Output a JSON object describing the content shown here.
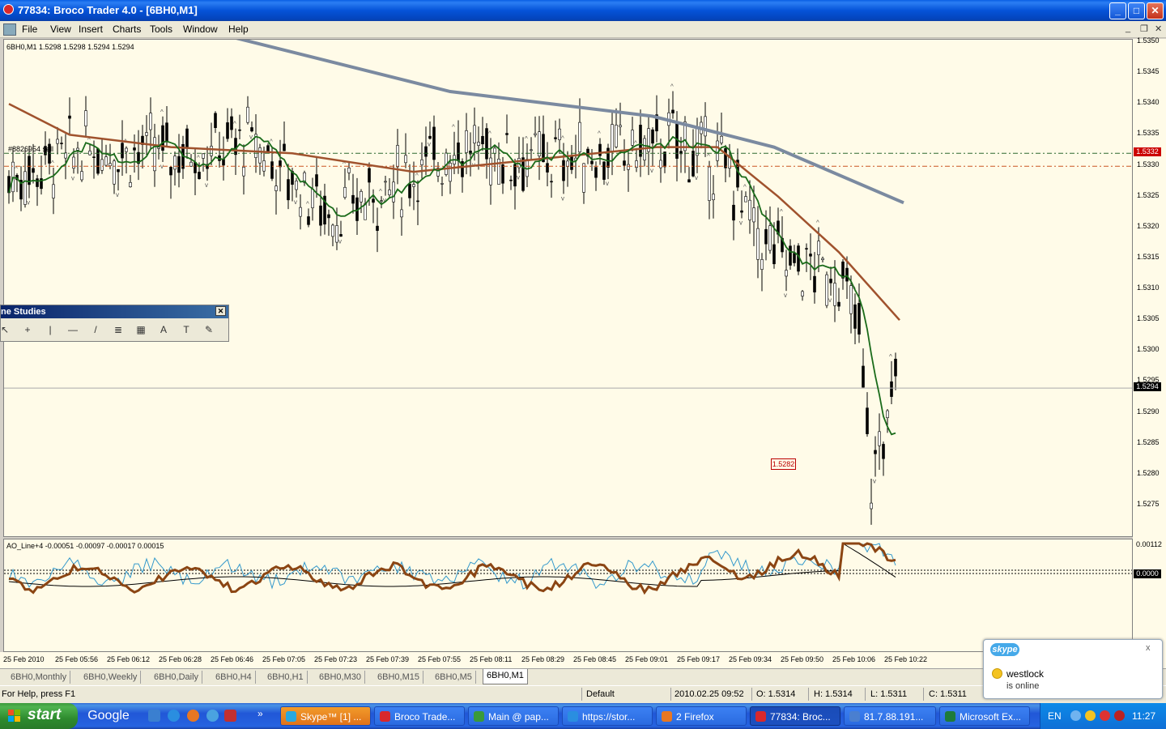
{
  "window": {
    "title": "77834: Broco Trader 4.0 - [6BH0,M1]",
    "buttons": {
      "minimize": "_",
      "maximize": "□",
      "close": "✕"
    }
  },
  "menu": [
    "File",
    "View",
    "Insert",
    "Charts",
    "Tools",
    "Window",
    "Help"
  ],
  "chart": {
    "header": "6BH0,M1  1.5298 1.5298 1.5294 1.5294",
    "current_price": "1.5294",
    "order_price": "1.5332",
    "order_label": "#8826954 sell",
    "alert_price": "1.5282",
    "price_ticks": [
      "1.5350",
      "1.5345",
      "1.5340",
      "1.5335",
      "1.5330",
      "1.5325",
      "1.5320",
      "1.5315",
      "1.5310",
      "1.5305",
      "1.5300",
      "1.5295",
      "1.5290",
      "1.5285",
      "1.5280",
      "1.5275"
    ],
    "time_ticks": [
      "25 Feb 2010",
      "25 Feb 05:56",
      "25 Feb 06:12",
      "25 Feb 06:28",
      "25 Feb 06:46",
      "25 Feb 07:05",
      "25 Feb 07:23",
      "25 Feb 07:39",
      "25 Feb 07:55",
      "25 Feb 08:11",
      "25 Feb 08:29",
      "25 Feb 08:45",
      "25 Feb 09:01",
      "25 Feb 09:17",
      "25 Feb 09:34",
      "25 Feb 09:50",
      "25 Feb 10:06",
      "25 Feb 10:22"
    ],
    "colors": {
      "background": "#fffbe8",
      "ma_slow": "#7b8aa0",
      "ma_mid": "#a0522d",
      "ma_fast": "#1a6b1a",
      "order_line": "#2f6b2f",
      "sl_line": "#cc5522",
      "price_box": "#000000",
      "order_box": "#cc0000"
    }
  },
  "indicator": {
    "header": "AO_Line+4 -0.00051 -0.00097 -0.00017 0.00015",
    "ticks": [
      "0.00112",
      "0.0000"
    ]
  },
  "line_studies": {
    "title": "ne Studies",
    "tools": [
      "cursor-tool",
      "crosshair-tool",
      "vertical-line-tool",
      "horizontal-line-tool",
      "trendline-tool",
      "channel-tool",
      "fibonacci-tool",
      "text-tool",
      "label-tool",
      "arrows-tool"
    ],
    "tool_glyphs": [
      "↖",
      "+",
      "|",
      "—",
      "/",
      "≣",
      "▦",
      "A",
      "T",
      "✎"
    ]
  },
  "tabs": [
    "6BH0,Monthly",
    "6BH0,Weekly",
    "6BH0,Daily",
    "6BH0,H4",
    "6BH0,H1",
    "6BH0,M30",
    "6BH0,M15",
    "6BH0,M5",
    "6BH0,M1"
  ],
  "active_tab": "6BH0,M1",
  "status": {
    "help": "For Help, press F1",
    "profile": "Default",
    "datetime": "2010.02.25 09:52",
    "open": "O: 1.5314",
    "high": "H: 1.5314",
    "low": "L: 1.5311",
    "close": "C: 1.5311"
  },
  "taskbar": {
    "start": "start",
    "quicklaunch_google": "Google",
    "items": [
      {
        "label": "Skype™ [1] ...",
        "icon": "skype-icon",
        "style": "orange"
      },
      {
        "label": "Broco Trade...",
        "icon": "broco-icon",
        "style": "normal"
      },
      {
        "label": "Main @ pap...",
        "icon": "app-icon",
        "style": "normal"
      },
      {
        "label": "https://stor...",
        "icon": "ie-icon",
        "style": "normal"
      },
      {
        "label": "2 Firefox",
        "icon": "firefox-icon",
        "style": "normal"
      },
      {
        "label": "77834: Broc...",
        "icon": "broco-icon",
        "style": "active"
      },
      {
        "label": "81.7.88.191...",
        "icon": "remote-icon",
        "style": "normal"
      },
      {
        "label": "Microsoft Ex...",
        "icon": "excel-icon",
        "style": "normal"
      }
    ],
    "lang": "EN",
    "clock": "11:27"
  },
  "skype_popup": {
    "brand": "skype",
    "name": "westlock",
    "status": "is online",
    "close": "x"
  }
}
